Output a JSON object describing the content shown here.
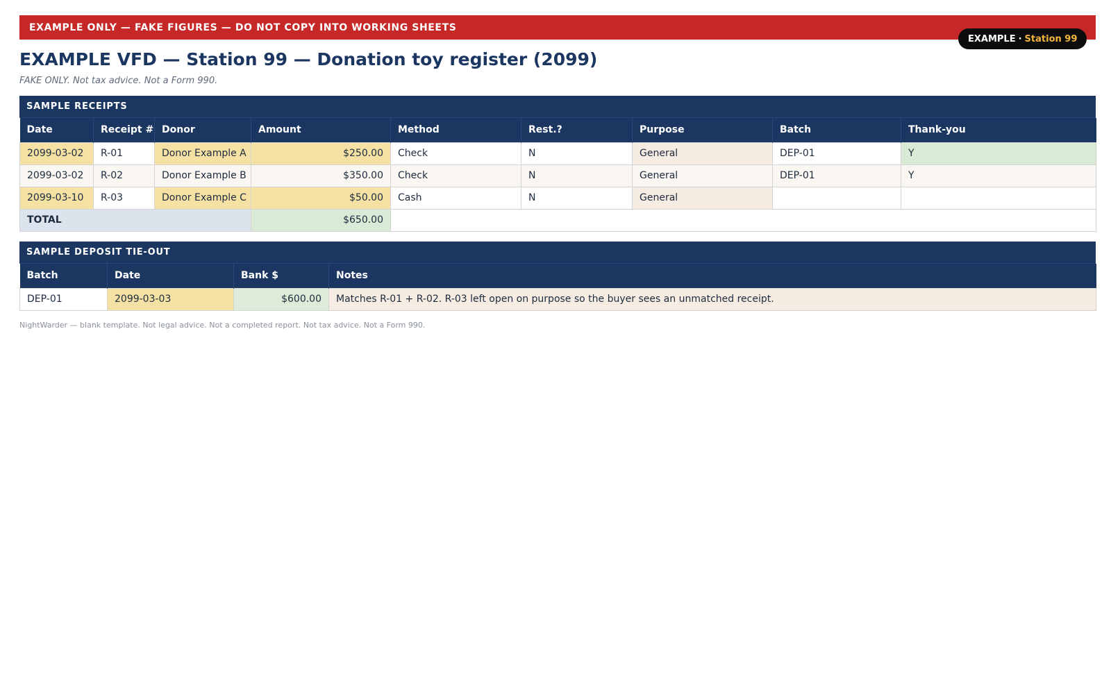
{
  "banner": {
    "text": "EXAMPLE ONLY — FAKE FIGURES — DO NOT COPY INTO WORKING SHEETS"
  },
  "badge": {
    "prefix": "EXAMPLE",
    "separator": "·",
    "station": "Station 99"
  },
  "header": {
    "title": "EXAMPLE VFD — Station 99 — Donation toy register (2099)",
    "subtitle": "FAKE ONLY. Not tax advice. Not a Form 990."
  },
  "receipts": {
    "section_title": "SAMPLE RECEIPTS",
    "columns": [
      "Date",
      "Receipt #",
      "Donor",
      "Amount",
      "Method",
      "Rest.?",
      "Purpose",
      "Batch",
      "Thank-you"
    ],
    "rows": [
      {
        "date": "2099-03-02",
        "receipt": "R-01",
        "donor": "Donor Example A",
        "amount": "$250.00",
        "method": "Check",
        "restricted": "N",
        "purpose": "General",
        "batch": "DEP-01",
        "thank_you": "Y"
      },
      {
        "date": "2099-03-02",
        "receipt": "R-02",
        "donor": "Donor Example B",
        "amount": "$350.00",
        "method": "Check",
        "restricted": "N",
        "purpose": "General",
        "batch": "DEP-01",
        "thank_you": "Y"
      },
      {
        "date": "2099-03-10",
        "receipt": "R-03",
        "donor": "Donor Example C",
        "amount": "$50.00",
        "method": "Cash",
        "restricted": "N",
        "purpose": "General",
        "batch": "",
        "thank_you": ""
      }
    ],
    "total": {
      "label": "TOTAL",
      "amount": "$650.00"
    }
  },
  "deposit": {
    "section_title": "SAMPLE DEPOSIT TIE-OUT",
    "columns": [
      "Batch",
      "Date",
      "Bank $",
      "Notes"
    ],
    "rows": [
      {
        "batch": "DEP-01",
        "date": "2099-03-03",
        "bank_amount": "$600.00",
        "notes": "Matches R-01 + R-02. R-03 left open on purpose so the buyer sees an unmatched receipt."
      }
    ]
  },
  "footer": {
    "text": "NightWarder — blank template. Not legal advice. Not a completed report. Not tax advice. Not a Form 990."
  },
  "colors": {
    "banner": "#c62828",
    "header_navy": "#1b3660",
    "highlight_yellow": "#f5e1a3",
    "highlight_green": "#d9ead6",
    "highlight_cream": "#f6ece2",
    "badge_accent": "#f4b53f"
  }
}
